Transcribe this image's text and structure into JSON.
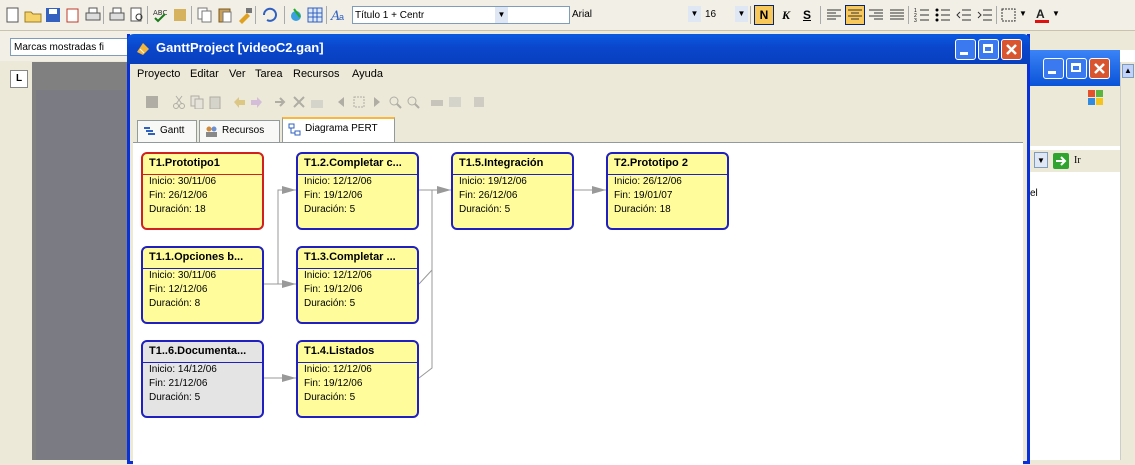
{
  "word": {
    "toolbar": {
      "style_combo": "Título 1 + Centr",
      "font_combo": "Arial",
      "size_combo": "16",
      "bold": "N",
      "italic": "K",
      "underline": "S"
    },
    "marcas": "Marcas mostradas fi",
    "ruler_corner": "L"
  },
  "ie": {
    "go_label": "Ir",
    "partial_text": "el"
  },
  "gantt": {
    "title": "GanttProject [videoC2.gan]",
    "menu": [
      "Proyecto",
      "Editar",
      "Ver",
      "Tarea",
      "Recursos",
      "Ayuda"
    ],
    "tabs": [
      {
        "label": "Gantt"
      },
      {
        "label": "Recursos"
      },
      {
        "label": "Diagrama PERT"
      }
    ],
    "nodes": [
      {
        "name": "T1.Prototipo1",
        "inicio": "Inicio: 30/11/06",
        "fin": "Fin: 26/12/06",
        "duracion": "Duración: 18"
      },
      {
        "name": "T1.2.Completar c...",
        "inicio": "Inicio: 12/12/06",
        "fin": "Fin: 19/12/06",
        "duracion": "Duración: 5"
      },
      {
        "name": "T1.5.Integración",
        "inicio": "Inicio: 19/12/06",
        "fin": "Fin: 26/12/06",
        "duracion": "Duración: 5"
      },
      {
        "name": "T2.Prototipo 2",
        "inicio": "Inicio: 26/12/06",
        "fin": "Fin: 19/01/07",
        "duracion": "Duración: 18"
      },
      {
        "name": "T1.1.Opciones b...",
        "inicio": "Inicio: 30/11/06",
        "fin": "Fin: 12/12/06",
        "duracion": "Duración: 8"
      },
      {
        "name": "T1.3.Completar ...",
        "inicio": "Inicio: 12/12/06",
        "fin": "Fin: 19/12/06",
        "duracion": "Duración: 5"
      },
      {
        "name": "T1..6.Documenta...",
        "inicio": "Inicio: 14/12/06",
        "fin": "Fin: 21/12/06",
        "duracion": "Duración: 5"
      },
      {
        "name": "T1.4.Listados",
        "inicio": "Inicio: 12/12/06",
        "fin": "Fin: 19/12/06",
        "duracion": "Duración: 5"
      }
    ]
  }
}
